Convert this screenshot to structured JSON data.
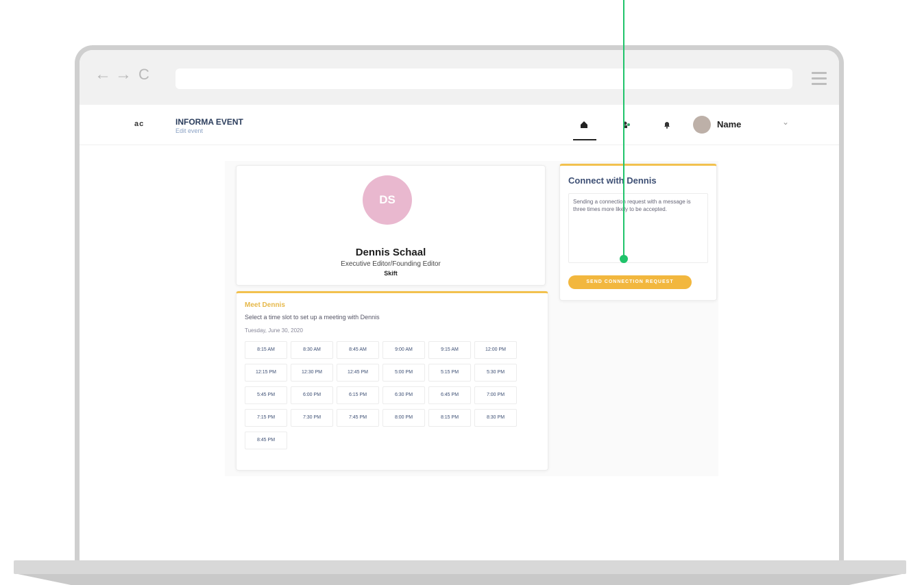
{
  "browser": {
    "back_icon": "←",
    "forward_icon": "→",
    "reload_icon": "C",
    "url": ""
  },
  "header": {
    "logo": "ac",
    "event_title": "INFORMA EVENT",
    "event_subtitle": "Edit event",
    "user_name": "Name",
    "caret": "⌄"
  },
  "profile": {
    "initials": "DS",
    "name": "Dennis Schaal",
    "title": "Executive Editor/Founding Editor",
    "company": "Skift"
  },
  "meet": {
    "title": "Meet Dennis",
    "description": "Select a time slot to set up a meeting with Dennis",
    "date": "Tuesday, June 30, 2020",
    "slots": [
      "8:15 AM",
      "8:30 AM",
      "8:45 AM",
      "9:00 AM",
      "9:15 AM",
      "12:00 PM",
      "12:15 PM",
      "12:30 PM",
      "12:45 PM",
      "5:00 PM",
      "5:15 PM",
      "5:30 PM",
      "5:45 PM",
      "6:00 PM",
      "6:15 PM",
      "6:30 PM",
      "6:45 PM",
      "7:00 PM",
      "7:15 PM",
      "7:30 PM",
      "7:45 PM",
      "8:00 PM",
      "8:15 PM",
      "8:30 PM",
      "8:45 PM"
    ]
  },
  "connect": {
    "title": "Connect with Dennis",
    "message": "Sending a connection request with a message is three times more likely to be accepted.",
    "button_label": "SEND CONNECTION REQUEST"
  },
  "colors": {
    "accent": "#f2b73e",
    "annotation": "#1fc36a",
    "avatar": "#e9b8cf"
  }
}
